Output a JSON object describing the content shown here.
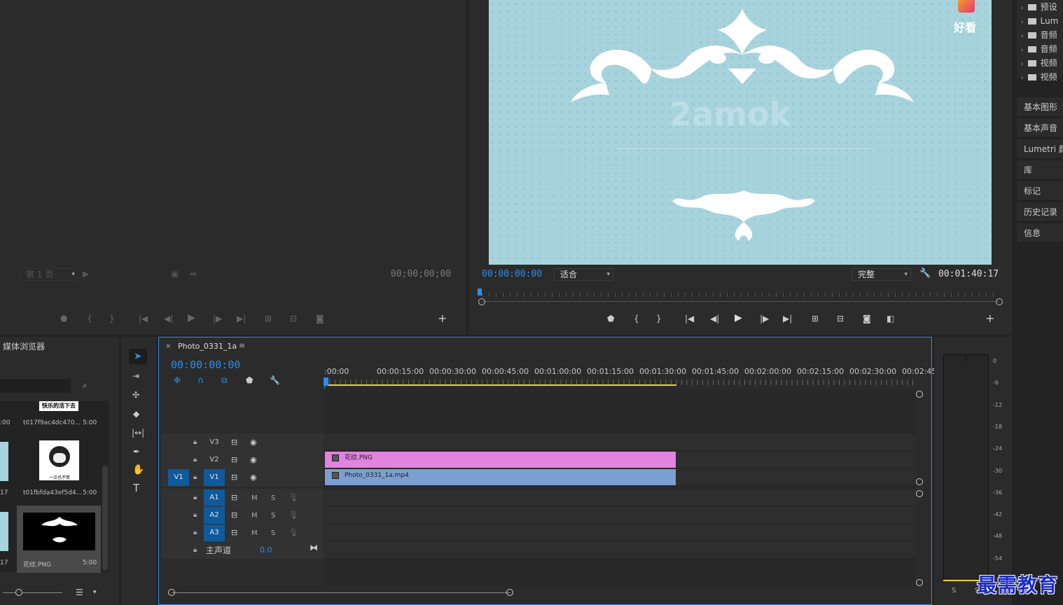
{
  "source_monitor": {
    "page_select": "第 1 页",
    "timecode": "00;00;00;00"
  },
  "program_monitor": {
    "timecode": "00:00:00:00",
    "fit_select": "适合",
    "quality_select": "完整",
    "duration": "00:01:40:17",
    "overlay_logo": "好看",
    "video_watermark": "2amok"
  },
  "side_panel": {
    "tree": [
      "预设",
      "Lum",
      "音频",
      "音频",
      "视频",
      "视频"
    ],
    "items": [
      "基本图形",
      "基本声音",
      "Lumetri 颜",
      "库",
      "标记",
      "历史记录",
      "信息"
    ]
  },
  "media_browser": {
    "title": "媒体浏览器",
    "items": [
      {
        "name": "t017f9ac4dc470...",
        "duration": "5:00",
        "thumb_text": "快乐的活下去"
      },
      {
        "name": "t01fbfda43ef5d4...",
        "duration": "5:00",
        "thumb_text": "一点也不慌"
      },
      {
        "name": "花纹.PNG",
        "duration": "5:00",
        "thumb_text": ""
      }
    ],
    "left_col": [
      ":00",
      "17",
      "17"
    ]
  },
  "timeline": {
    "sequence_name": "Photo_0331_1a",
    "timecode": "00:00:00:00",
    "ruler": [
      ":00:00",
      "00:00:15:00",
      "00:00:30:00",
      "00:00:45:00",
      "00:01:00:00",
      "00:01:15:00",
      "00:01:30:00",
      "00:01:45:00",
      "00:02:00:00",
      "00:02:15:00",
      "00:02:30:00",
      "00:02:45:"
    ],
    "video_tracks": [
      "V3",
      "V2",
      "V1"
    ],
    "source_patch": "V1",
    "audio_tracks": [
      "A1",
      "A2",
      "A3"
    ],
    "mute_label": "M",
    "solo_label": "S",
    "master_label": "主声道",
    "master_value": "0.0",
    "clips": [
      {
        "name": "花纹.PNG",
        "track": "V2",
        "color": "#e383e0"
      },
      {
        "name": "Photo_0331_1a.mp4",
        "track": "V1",
        "color": "#7b9fd0"
      }
    ]
  },
  "audio_meter": {
    "ticks": [
      "0",
      "-6",
      "-12",
      "-18",
      "-24",
      "-30",
      "-36",
      "-42",
      "-48",
      "-54"
    ],
    "solo_labels": [
      "S",
      "S"
    ]
  },
  "watermark": "最需教育",
  "colors": {
    "accent": "#2d8ceb",
    "video_bg": "#a7d3dd",
    "pink_clip": "#e383e0",
    "blue_clip": "#7b9fd0"
  }
}
